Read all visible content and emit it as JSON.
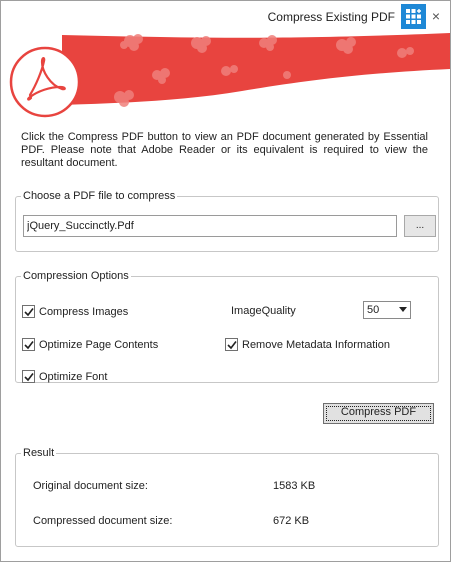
{
  "window": {
    "title": "Compress Existing PDF",
    "app_icon": "app-grid-icon",
    "close_glyph": "×",
    "accent_color": "#1e88d6",
    "banner_color": "#e8443f"
  },
  "description": "Click the Compress PDF button to view an PDF document generated by Essential PDF. Please note that Adobe Reader or its equivalent is required to view the resultant document.",
  "file_group": {
    "legend": "Choose a PDF file to compress",
    "file_value": "jQuery_Succinctly.Pdf",
    "browse_label": "..."
  },
  "options": {
    "legend": "Compression Options",
    "compress_images": {
      "label": "Compress Images",
      "checked": true
    },
    "optimize_page_contents": {
      "label": "Optimize Page Contents",
      "checked": true
    },
    "optimize_font": {
      "label": "Optimize Font",
      "checked": true
    },
    "remove_metadata": {
      "label": "Remove Metadata Information",
      "checked": true
    },
    "image_quality_label": "ImageQuality",
    "image_quality_value": "50"
  },
  "compress_button": "Compress PDF",
  "result": {
    "legend": "Result",
    "original_label": "Original document size:",
    "original_value": "1583 KB",
    "compressed_label": "Compressed document size:",
    "compressed_value": "672 KB"
  }
}
